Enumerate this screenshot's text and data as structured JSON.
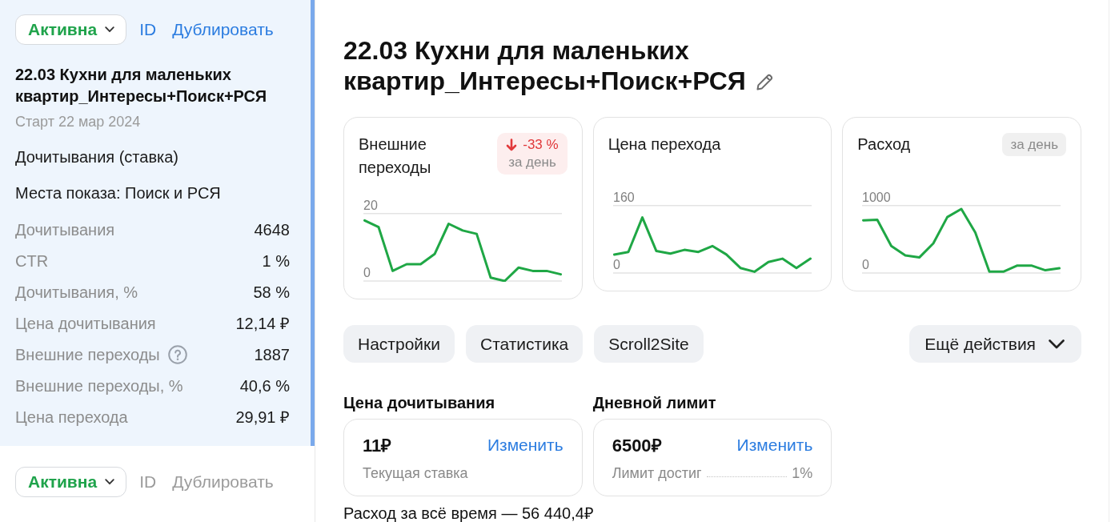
{
  "sidebar": {
    "campaigns": [
      {
        "selected": true,
        "status": "Активна",
        "id_link": "ID",
        "duplicate_link": "Дублировать",
        "title": "22.03 Кухни для маленьких квартир_Интересы+Поиск+РСЯ",
        "start": "Старт 22 мар 2024",
        "strategy": "Дочитывания (ставка)",
        "placements": "Места показа: Поиск и РСЯ",
        "metrics": [
          {
            "label": "Дочитывания",
            "value": "4648",
            "help": false
          },
          {
            "label": "CTR",
            "value": "1 %",
            "help": false
          },
          {
            "label": "Дочитывания, %",
            "value": "58 %",
            "help": false
          },
          {
            "label": "Цена дочитывания",
            "value": "12,14 ₽",
            "help": false
          },
          {
            "label": "Внешние переходы",
            "value": "1887",
            "help": true
          },
          {
            "label": "Внешние переходы, %",
            "value": "40,6 %",
            "help": false
          },
          {
            "label": "Цена перехода",
            "value": "29,91 ₽",
            "help": false
          }
        ]
      },
      {
        "selected": false,
        "status": "Активна",
        "id_link": "ID",
        "duplicate_link": "Дублировать"
      }
    ]
  },
  "main": {
    "title": "22.03 Кухни для маленьких квартир_Интересы+Поиск+РСЯ",
    "stat_cards": [
      {
        "title": "Внешние переходы",
        "badge": {
          "kind": "change",
          "decrease": true,
          "text": "-33 %",
          "period": "за день"
        },
        "chart_data": {
          "type": "line",
          "values": [
            18,
            16,
            3,
            5,
            5,
            8,
            17,
            15,
            14,
            1,
            0,
            4,
            3,
            3,
            2
          ],
          "ylim": [
            0,
            24
          ],
          "yticks": [
            0,
            20
          ]
        }
      },
      {
        "title": "Цена перехода",
        "chart_data": {
          "type": "line",
          "values": [
            44,
            50,
            132,
            52,
            46,
            55,
            50,
            64,
            44,
            12,
            3,
            26,
            34,
            12,
            34
          ],
          "ylim": [
            0,
            192
          ],
          "yticks": [
            0,
            160
          ]
        }
      },
      {
        "title": "Расход",
        "badge": {
          "kind": "period",
          "period": "за день"
        },
        "chart_data": {
          "type": "line",
          "values": [
            780,
            790,
            400,
            260,
            230,
            440,
            830,
            950,
            600,
            20,
            20,
            110,
            110,
            40,
            70
          ],
          "ylim": [
            0,
            1200
          ],
          "yticks": [
            0,
            1000
          ]
        }
      }
    ],
    "actions": [
      {
        "label": "Настройки",
        "kind": "button"
      },
      {
        "label": "Статистика",
        "kind": "button"
      },
      {
        "label": "Scroll2Site",
        "kind": "button"
      },
      {
        "label": "Ещё действия",
        "kind": "menu"
      }
    ],
    "settings": [
      {
        "heading": "Цена дочитывания",
        "value": "11₽",
        "link": "Изменить",
        "caption": "Текущая ставка"
      },
      {
        "heading": "Дневной лимит",
        "value": "6500₽",
        "link": "Изменить",
        "caption": "Лимит достиг",
        "reading": "1%"
      }
    ],
    "total_spend": "Расход за всё время — 56 440,4₽"
  }
}
